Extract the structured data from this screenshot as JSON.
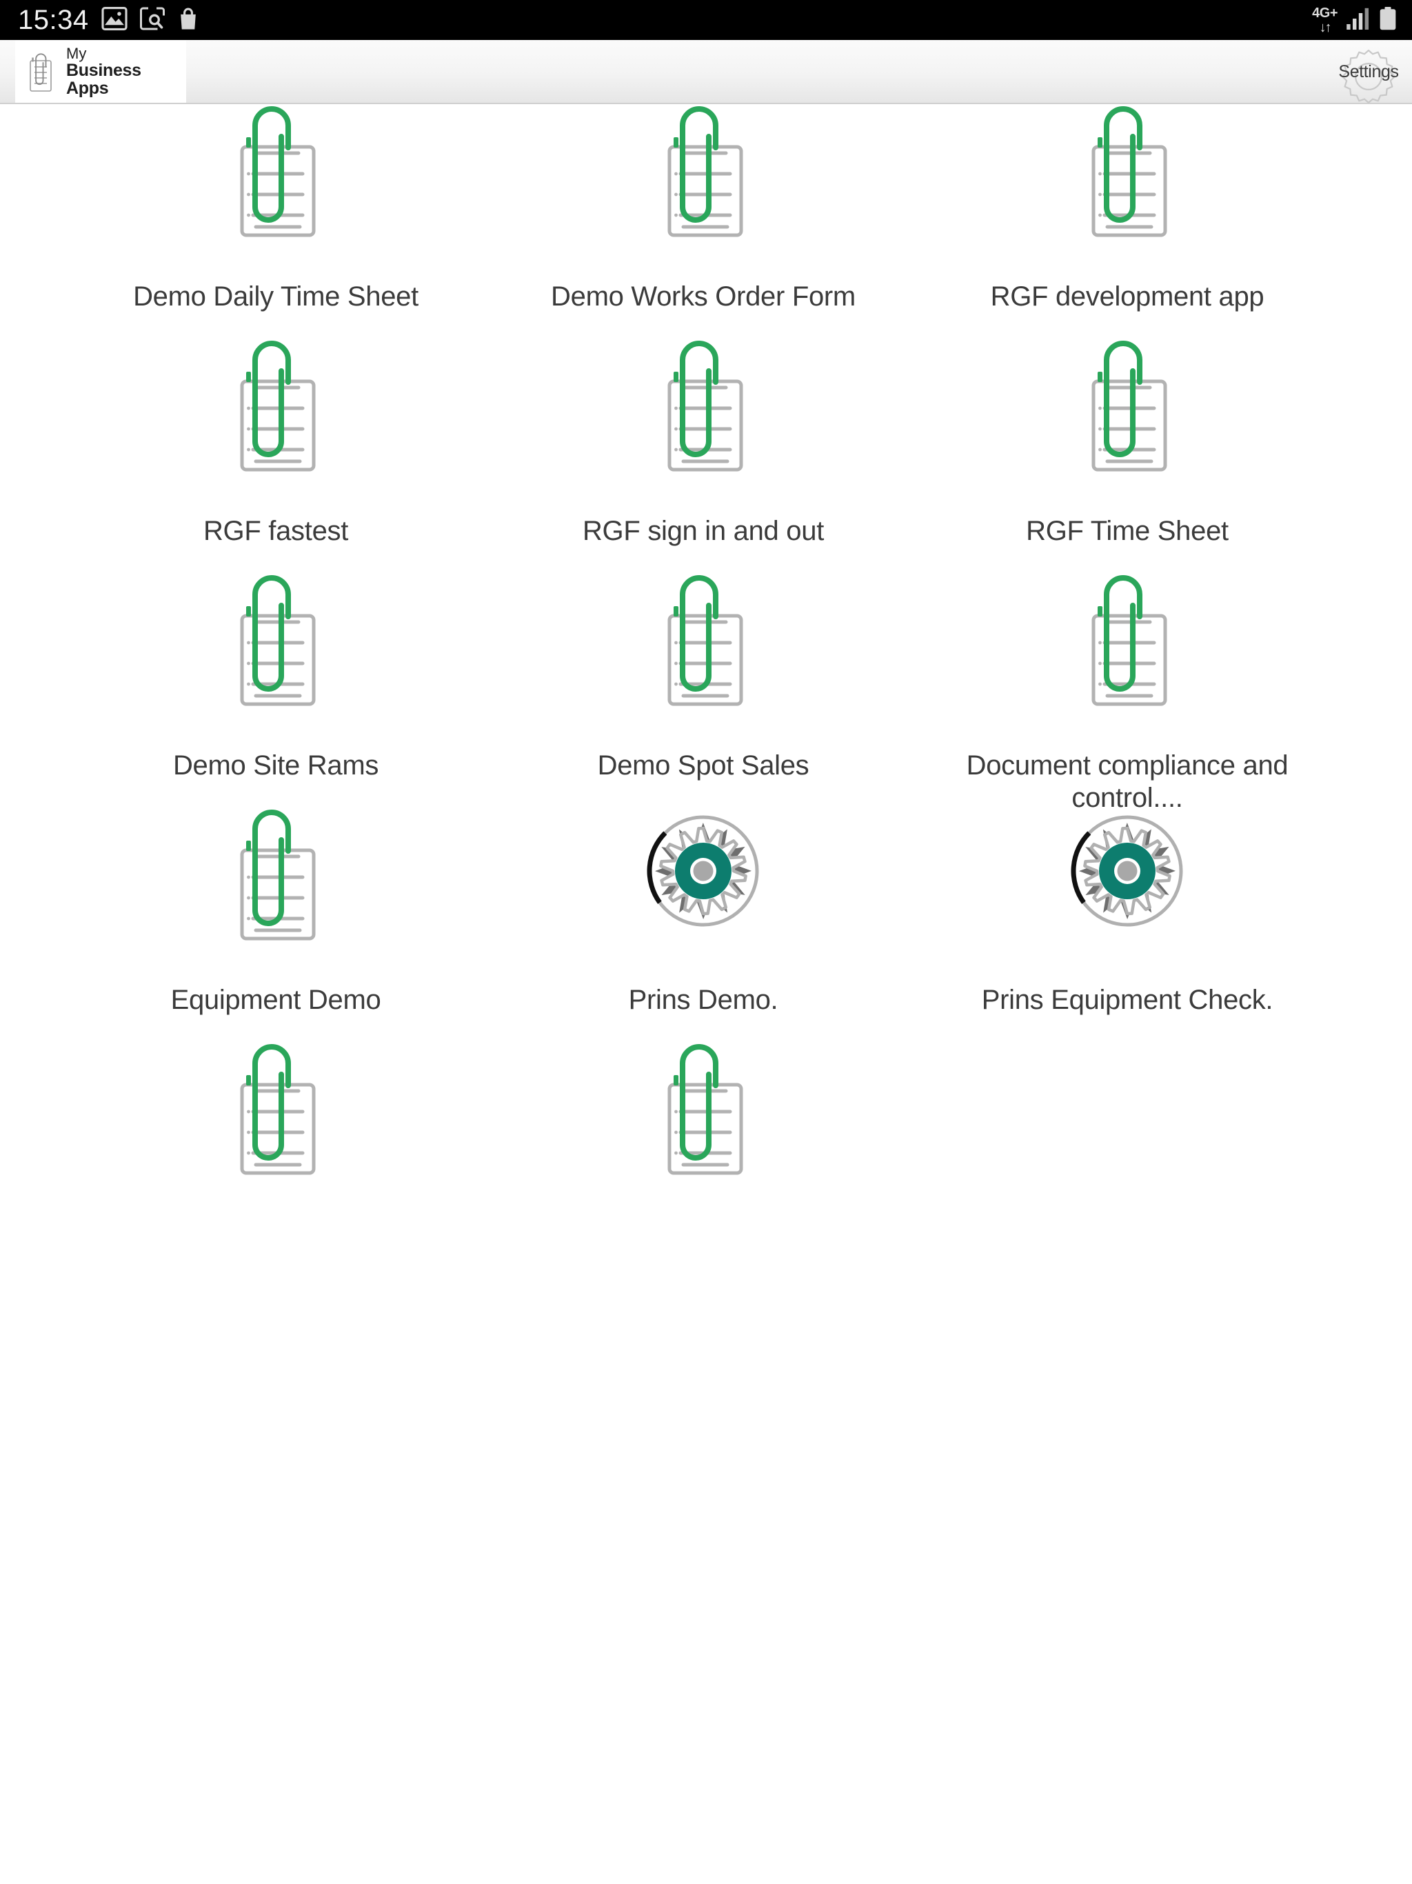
{
  "statusbar": {
    "time": "15:34",
    "left_icons": [
      "image-icon",
      "screenshot-search-icon",
      "shopping-bag-icon"
    ],
    "network_type": "4G+",
    "network_arrows": "↓↑",
    "right_icons": [
      "signal-bars-icon",
      "battery-icon"
    ]
  },
  "header": {
    "logo_icon": "paperclip-document-icon",
    "logo_line1": "My",
    "logo_line2": "Business Apps",
    "settings_label": "Settings",
    "settings_icon": "gear-icon"
  },
  "colors": {
    "paperclip_green": "#2aa65a",
    "document_grey": "#b2b2b2",
    "gear_teal": "#0d7d6e",
    "gear_grey": "#6e6e6e",
    "gear_outline": "#b0b0b0",
    "arc_black": "#111111",
    "arc_grey": "#b0b0b0",
    "label_text": "#3b3b3b",
    "statusbar_bg": "#000000",
    "header_bg": "#f0f0f0"
  },
  "grid": {
    "columns": 3,
    "apps": [
      {
        "label": "Demo Daily Time Sheet",
        "icon": "paperclip-document-icon",
        "row": 0,
        "col": 0
      },
      {
        "label": "Demo Works Order Form",
        "icon": "paperclip-document-icon",
        "row": 0,
        "col": 1
      },
      {
        "label": "RGF development app",
        "icon": "paperclip-document-icon",
        "row": 0,
        "col": 2
      },
      {
        "label": "RGF fastest",
        "icon": "paperclip-document-icon",
        "row": 1,
        "col": 0
      },
      {
        "label": "RGF sign in and out",
        "icon": "paperclip-document-icon",
        "row": 1,
        "col": 1
      },
      {
        "label": "RGF Time Sheet",
        "icon": "paperclip-document-icon",
        "row": 1,
        "col": 2
      },
      {
        "label": "Demo Site Rams",
        "icon": "paperclip-document-icon",
        "row": 2,
        "col": 0
      },
      {
        "label": "Demo Spot Sales",
        "icon": "paperclip-document-icon",
        "row": 2,
        "col": 1
      },
      {
        "label": "Document compliance and control....",
        "icon": "paperclip-document-icon",
        "row": 2,
        "col": 2
      },
      {
        "label": "Equipment Demo",
        "icon": "paperclip-document-icon",
        "row": 3,
        "col": 0
      },
      {
        "label": "Prins Demo.",
        "icon": "gear-arc-icon",
        "row": 3,
        "col": 1
      },
      {
        "label": "Prins Equipment Check.",
        "icon": "gear-arc-icon",
        "row": 3,
        "col": 2
      },
      {
        "label": "",
        "icon": "paperclip-document-icon",
        "row": 4,
        "col": 0
      },
      {
        "label": "",
        "icon": "paperclip-document-icon",
        "row": 4,
        "col": 1
      }
    ]
  }
}
